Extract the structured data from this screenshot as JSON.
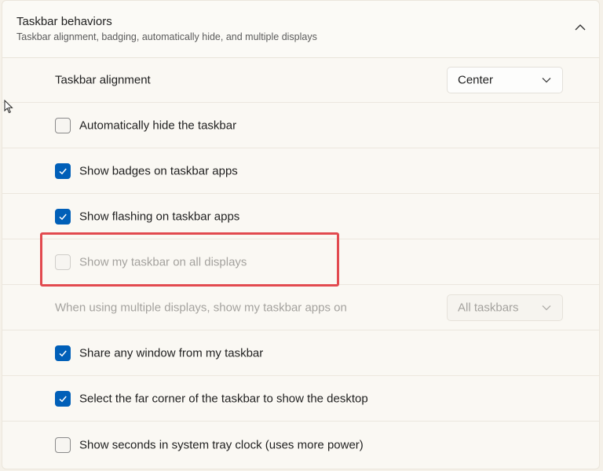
{
  "section": {
    "title": "Taskbar behaviors",
    "subtitle": "Taskbar alignment, badging, automatically hide, and multiple displays",
    "expanded_icon": "chevron-up-icon"
  },
  "settings": {
    "alignment": {
      "label": "Taskbar alignment",
      "value": "Center"
    },
    "auto_hide": {
      "label": "Automatically hide the taskbar",
      "checked": false
    },
    "badges": {
      "label": "Show badges on taskbar apps",
      "checked": true
    },
    "flashing": {
      "label": "Show flashing on taskbar apps",
      "checked": true
    },
    "all_displays": {
      "label": "Show my taskbar on all displays",
      "checked": false,
      "disabled": true
    },
    "multi_display_apps": {
      "label": "When using multiple displays, show my taskbar apps on",
      "value": "All taskbars",
      "disabled": true
    },
    "share_window": {
      "label": "Share any window from my taskbar",
      "checked": true
    },
    "far_corner": {
      "label": "Select the far corner of the taskbar to show the desktop",
      "checked": true
    },
    "seconds_clock": {
      "label": "Show seconds in system tray clock (uses more power)",
      "checked": false
    }
  },
  "colors": {
    "accent": "#005fb8",
    "highlight": "#e24a4f",
    "disabled_text": "#a4a29e"
  }
}
